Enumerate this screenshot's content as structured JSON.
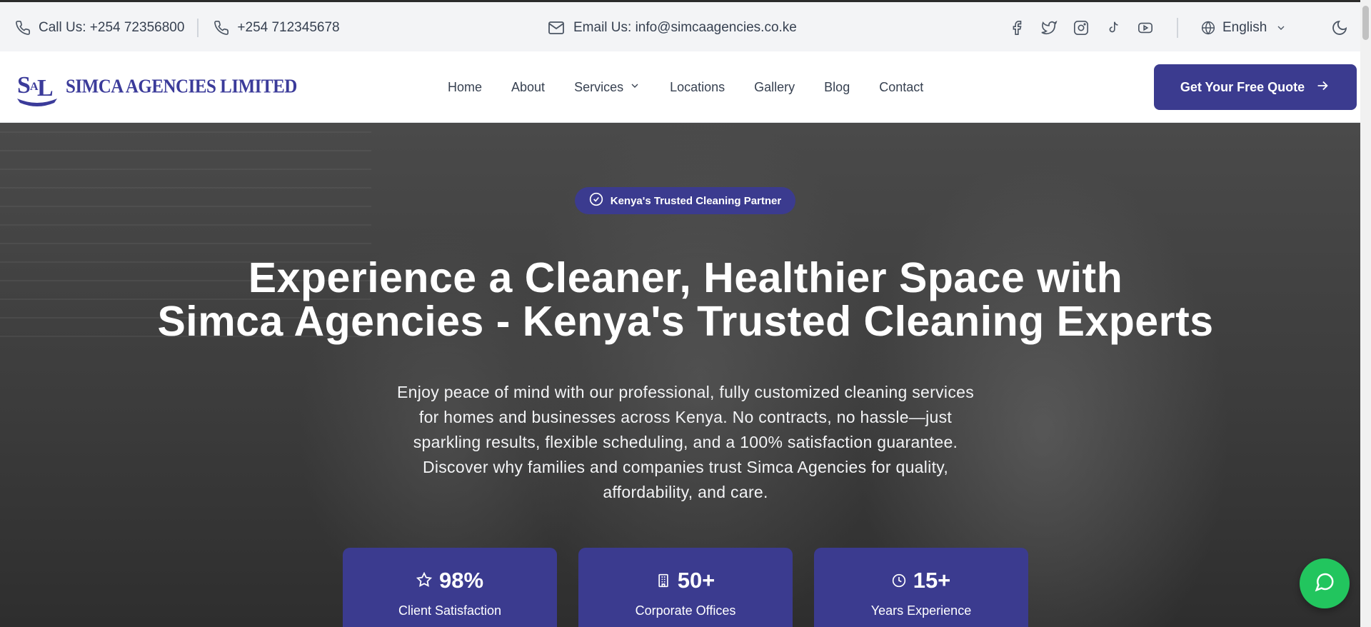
{
  "topbar": {
    "call_label": "Call Us: +254 72356800",
    "phone2": "+254 712345678",
    "email_label": "Email Us: info@simcaagencies.co.ke",
    "social_icons": [
      "facebook-icon",
      "twitter-icon",
      "instagram-icon",
      "tiktok-icon",
      "youtube-icon"
    ],
    "language": "English"
  },
  "nav": {
    "logo_text": "SIMCA AGENCIES LIMITED",
    "items": [
      "Home",
      "About",
      "Services",
      "Locations",
      "Gallery",
      "Blog",
      "Contact"
    ],
    "cta": "Get Your Free Quote"
  },
  "hero": {
    "badge": "Kenya's Trusted Cleaning Partner",
    "title_line1": "Experience a Cleaner, Healthier Space with",
    "title_line2": "Simca Agencies - Kenya's Trusted Cleaning Experts",
    "description": "Enjoy peace of mind with our professional, fully customized cleaning services for homes and businesses across Kenya. No contracts, no hassle—just sparkling results, flexible scheduling, and a 100% satisfaction guarantee. Discover why families and companies trust Simca Agencies for quality, affordability, and care.",
    "stats": [
      {
        "icon": "star-icon",
        "value": "98%",
        "label": "Client Satisfaction"
      },
      {
        "icon": "building-icon",
        "value": "50+",
        "label": "Corporate Offices"
      },
      {
        "icon": "clock-icon",
        "value": "15+",
        "label": "Years Experience"
      }
    ]
  },
  "colors": {
    "brand": "#3b3b8f",
    "chat": "#22c55e",
    "topbar_bg": "#f3f4f6"
  }
}
